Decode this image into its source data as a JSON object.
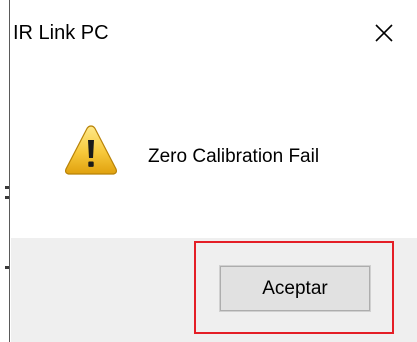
{
  "window": {
    "title": "IR Link PC",
    "close_icon": "close-icon"
  },
  "dialog": {
    "icon": "warning-icon",
    "message": "Zero Calibration Fail"
  },
  "buttons": {
    "ok_label": "Aceptar"
  },
  "colors": {
    "highlight_border": "#e41e26",
    "footer_background": "#efefef",
    "button_background": "#e1e1e1"
  }
}
